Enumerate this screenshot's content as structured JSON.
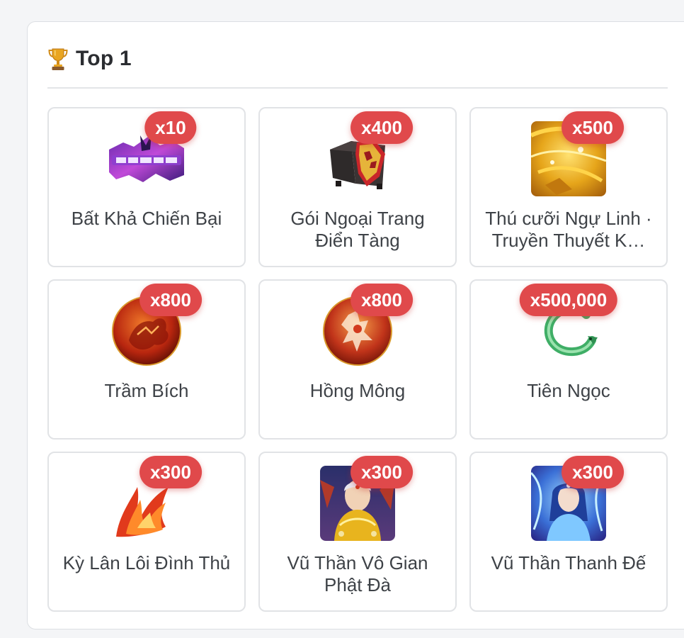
{
  "section": {
    "title": "Top 1",
    "icon": "trophy-icon"
  },
  "items": [
    {
      "name": "Bất Khả Chiến Bại",
      "qty": "x10",
      "icon": "title-banner-image"
    },
    {
      "name": "Gói Ngoại Trang Điển Tàng",
      "qty": "x400",
      "icon": "treasure-chest-image"
    },
    {
      "name": "Thú cưỡi Ngự Linh · Truyền Thuyết K…",
      "qty": "x500",
      "icon": "golden-mount-image"
    },
    {
      "name": "Trầm Bích",
      "qty": "x800",
      "icon": "red-dragon-orb-image"
    },
    {
      "name": "Hồng Mông",
      "qty": "x800",
      "icon": "red-spirit-orb-image"
    },
    {
      "name": "Tiên Ngọc",
      "qty": "x500,000",
      "icon": "jade-dragon-image"
    },
    {
      "name": "Kỳ Lân Lôi Đình Thủ",
      "qty": "x300",
      "icon": "fire-claw-image"
    },
    {
      "name": "Vũ Thần Vô Gian Phật Đà",
      "qty": "x300",
      "icon": "golden-deity-portrait"
    },
    {
      "name": "Vũ Thần Thanh Đế",
      "qty": "x300",
      "icon": "blue-goddess-portrait"
    }
  ],
  "colors": {
    "badge": "#e0494b",
    "card_border": "#e1e3e6",
    "text": "#3e4247"
  }
}
